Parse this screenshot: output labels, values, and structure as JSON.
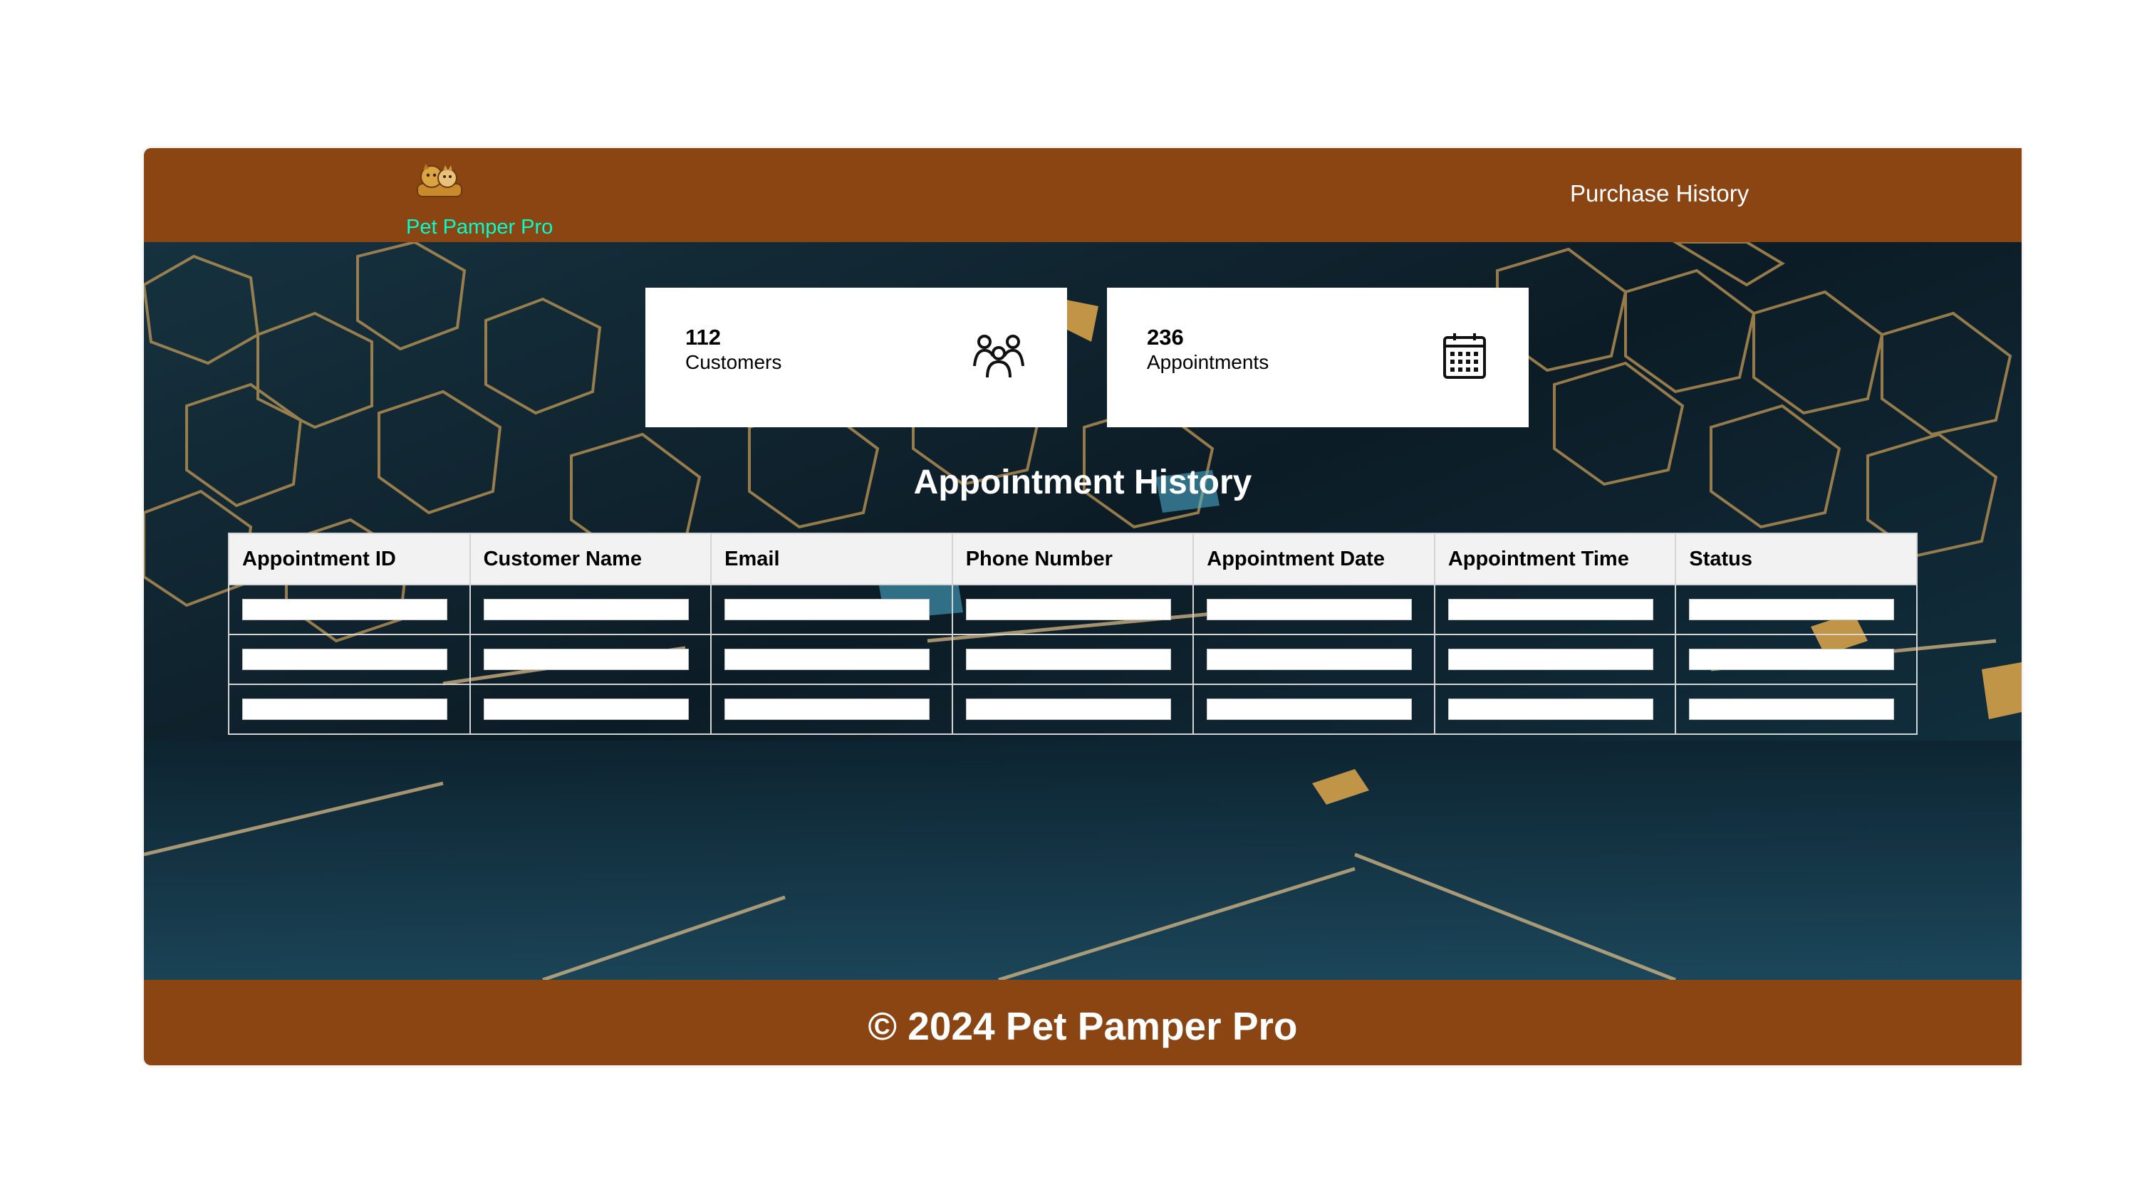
{
  "colors": {
    "brand_brown": "#8B4513",
    "brand_text": "#00FFCC",
    "nav_text": "#FFFFFF",
    "header_row_bg": "#F2F2F2"
  },
  "navbar": {
    "logo_icon": "pet-logo-icon",
    "brand_name": "Pet Pamper Pro",
    "links": [
      {
        "label": "Purchase History"
      }
    ]
  },
  "stats": [
    {
      "value": "112",
      "label": "Customers",
      "icon": "users-group-icon"
    },
    {
      "value": "236",
      "label": "Appointments",
      "icon": "calendar-icon"
    }
  ],
  "history": {
    "title": "Appointment History",
    "columns": [
      "Appointment ID",
      "Customer Name",
      "Email",
      "Phone Number",
      "Appointment Date",
      "Appointment Time",
      "Status"
    ],
    "rows": [
      [
        "",
        "",
        "",
        "",
        "",
        "",
        ""
      ],
      [
        "",
        "",
        "",
        "",
        "",
        "",
        ""
      ],
      [
        "",
        "",
        "",
        "",
        "",
        "",
        ""
      ]
    ]
  },
  "footer": {
    "text": "© 2024 Pet Pamper Pro"
  }
}
